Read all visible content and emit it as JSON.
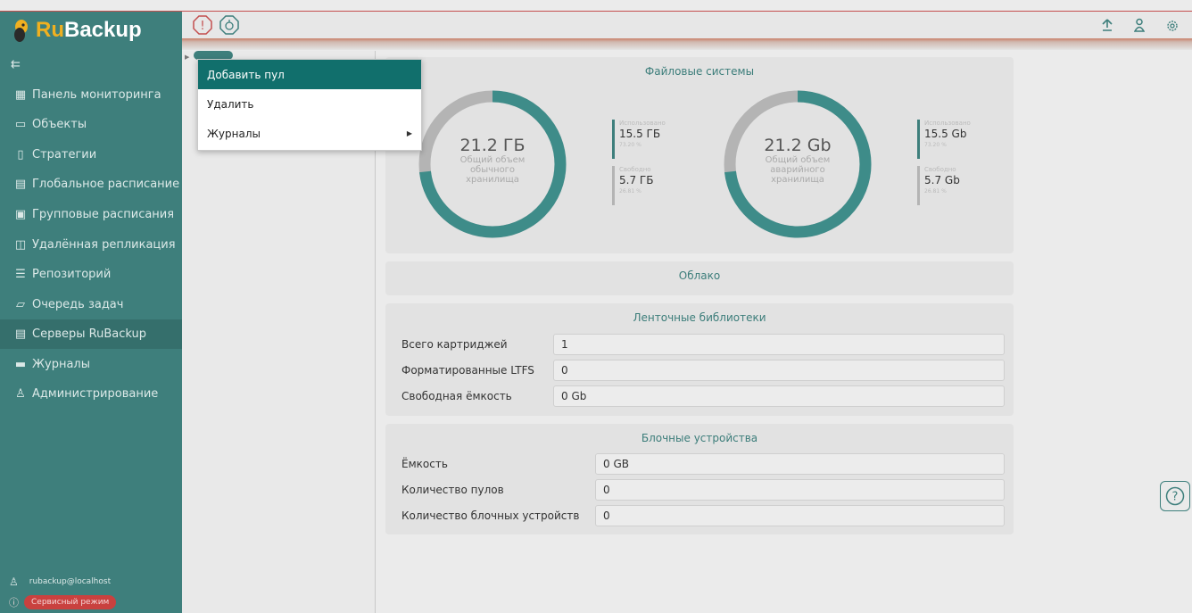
{
  "app": {
    "logo_prefix": "Ru",
    "logo_suffix": "Backup"
  },
  "colors": {
    "accent": "#3e7f7c",
    "used": "#3e8c89",
    "free": "#b4b4b4",
    "alert": "#c9413f"
  },
  "header_icons": [
    "alert-icon",
    "notification-icon",
    "upload-icon",
    "user-icon",
    "settings-icon"
  ],
  "sidebar": {
    "items": [
      {
        "label": "Панель мониторинга",
        "icon": "dashboard-icon"
      },
      {
        "label": "Объекты",
        "icon": "monitor-icon"
      },
      {
        "label": "Стратегии",
        "icon": "strategy-icon"
      },
      {
        "label": "Глобальное расписание",
        "icon": "schedule-icon"
      },
      {
        "label": "Групповые расписания",
        "icon": "group-schedule-icon"
      },
      {
        "label": "Удалённая репликация",
        "icon": "replication-icon"
      },
      {
        "label": "Репозиторий",
        "icon": "database-icon"
      },
      {
        "label": "Очередь задач",
        "icon": "queue-icon"
      },
      {
        "label": "Серверы RuBackup",
        "icon": "server-icon"
      },
      {
        "label": "Журналы",
        "icon": "log-icon"
      },
      {
        "label": "Администрирование",
        "icon": "admin-icon"
      }
    ],
    "active_index": 8,
    "user": "rubackup@localhost",
    "mode_badge": "Сервисный режим"
  },
  "context_menu": {
    "items": [
      {
        "label": "Добавить пул"
      },
      {
        "label": "Удалить"
      },
      {
        "label": "Журналы"
      }
    ]
  },
  "filesystems": {
    "title": "Файловые системы",
    "normal": {
      "total": "21.2 ГБ",
      "subtitle": [
        "Общий объем",
        "обычного",
        "хранилища"
      ],
      "used_label": "Использовано",
      "used": "15.5 ГБ",
      "used_pct": "73.20 %",
      "used_fraction": 0.732,
      "free_label": "Свободно",
      "free": "5.7 ГБ",
      "free_pct": "26.81 %"
    },
    "emergency": {
      "total": "21.2 Gb",
      "subtitle": [
        "Общий объем",
        "аварийного",
        "хранилища"
      ],
      "used_label": "Использовано",
      "used": "15.5 Gb",
      "used_pct": "73.20 %",
      "used_fraction": 0.732,
      "free_label": "Свободно",
      "free": "5.7 Gb",
      "free_pct": "26.81 %"
    }
  },
  "cloud": {
    "title": "Облако"
  },
  "tape": {
    "title": "Ленточные библиотеки",
    "rows": [
      {
        "label": "Всего картриджей",
        "value": "1"
      },
      {
        "label": "Форматированные LTFS",
        "value": "0"
      },
      {
        "label": "Свободная ёмкость",
        "value": "0 Gb"
      }
    ]
  },
  "block": {
    "title": "Блочные устройства",
    "rows": [
      {
        "label": "Ёмкость",
        "value": "0 GB"
      },
      {
        "label": "Количество пулов",
        "value": "0"
      },
      {
        "label": "Количество блочных устройств",
        "value": "0"
      }
    ]
  },
  "help": {
    "symbol": "?"
  }
}
